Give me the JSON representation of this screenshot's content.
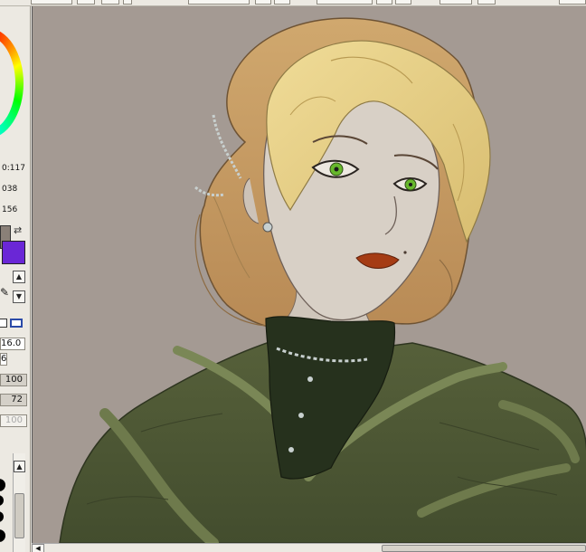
{
  "toolbar": {
    "buttons": [
      "tool-button",
      "tool-button",
      "tool-button",
      "dropdown",
      "tool-button",
      "tool-button",
      "dropdown",
      "tool-button",
      "tool-button",
      "dropdown",
      "tool-button"
    ]
  },
  "color_panel": {
    "readout_1": "0:117",
    "readout_2": "038",
    "readout_3": "156",
    "foreground_color": "#6a27d6",
    "background_color": "#8a8078"
  },
  "brush": {
    "size": "16.0",
    "min_size": "6",
    "density": "100",
    "blending": "72",
    "dilution": "100"
  },
  "colors": {
    "canvas_bg": "#a49a93",
    "hair_blonde": "#e6cf84",
    "hair_brown": "#c3955e",
    "skin": "#d8d0c6",
    "dress_green": "#4f5a35",
    "collar_green": "#26311d",
    "lips": "#a53c14",
    "eyes": "#67b82c"
  }
}
